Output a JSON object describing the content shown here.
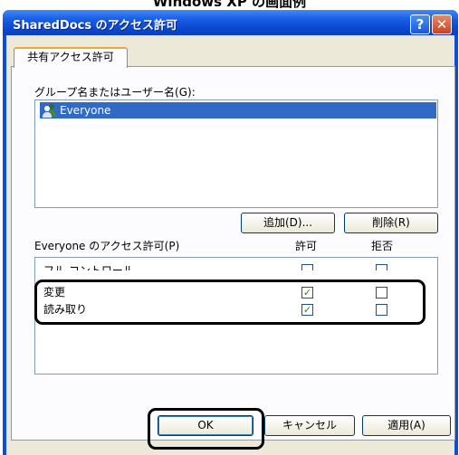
{
  "caption": "Windows XP の画面例",
  "window": {
    "title": "SharedDocs のアクセス許可",
    "help_label": "?",
    "close_label": "X"
  },
  "tab": {
    "label": "共有アクセス許可"
  },
  "users": {
    "label": "グループ名またはユーザー名(G):",
    "items": [
      {
        "name": "Everyone",
        "selected": true
      }
    ],
    "add_button": "追加(D)...",
    "remove_button": "削除(R)"
  },
  "permissions": {
    "label": "Everyone のアクセス許可(P)",
    "allow_header": "許可",
    "deny_header": "拒否",
    "rows": [
      {
        "name": "フル コントロール",
        "allow": false,
        "deny": false
      },
      {
        "name": "変更",
        "allow": true,
        "deny": false
      },
      {
        "name": "読み取り",
        "allow": true,
        "deny": false
      }
    ]
  },
  "footer": {
    "ok": "OK",
    "cancel": "キャンセル",
    "apply": "適用(A)"
  },
  "colors": {
    "title_bar": "#0a4fd6",
    "selection": "#316ac5",
    "dialog_bg": "#ece9d8",
    "tab_accent": "#f2a630"
  }
}
